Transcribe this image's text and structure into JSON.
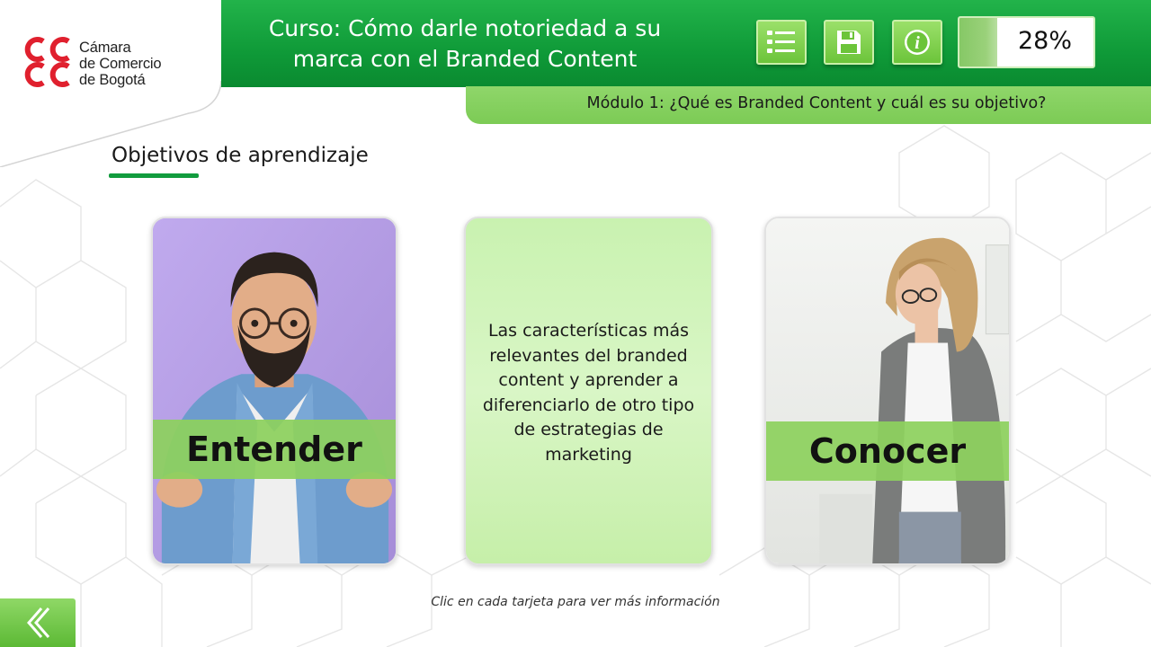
{
  "brand": {
    "logo_lines": [
      "Cámara",
      "de Comercio",
      "de Bogotá"
    ],
    "accent_red": "#e0202e",
    "accent_green": "#129c3e",
    "light_green": "#8dd15e"
  },
  "header": {
    "course_title_line1": "Curso: Cómo darle notoriedad a su",
    "course_title_line2": "marca con el Branded Content",
    "buttons": [
      {
        "icon": "menu-list-icon",
        "label": "Menú"
      },
      {
        "icon": "save-icon",
        "label": "Guardar"
      },
      {
        "icon": "info-icon",
        "label": "Información"
      }
    ],
    "progress_fraction": 0.28,
    "progress_text": "28%"
  },
  "module": {
    "title": "Módulo 1: ¿Qué es Branded Content y cuál es su objetivo?"
  },
  "section": {
    "title": "Objetivos de aprendizaje"
  },
  "cards": [
    {
      "label": "Entender",
      "photo": "bearded-man-with-glasses-photo",
      "side": "front"
    },
    {
      "text": "Las características más relevantes del branded content y aprender a diferenciarlo de otro tipo de estrategias de marketing",
      "side": "back"
    },
    {
      "label": "Conocer",
      "photo": "woman-reading-document-photo",
      "side": "front"
    }
  ],
  "footer": {
    "hint": "Clic en cada tarjeta para ver más información",
    "back_icon": "chevron-left-double-icon"
  }
}
